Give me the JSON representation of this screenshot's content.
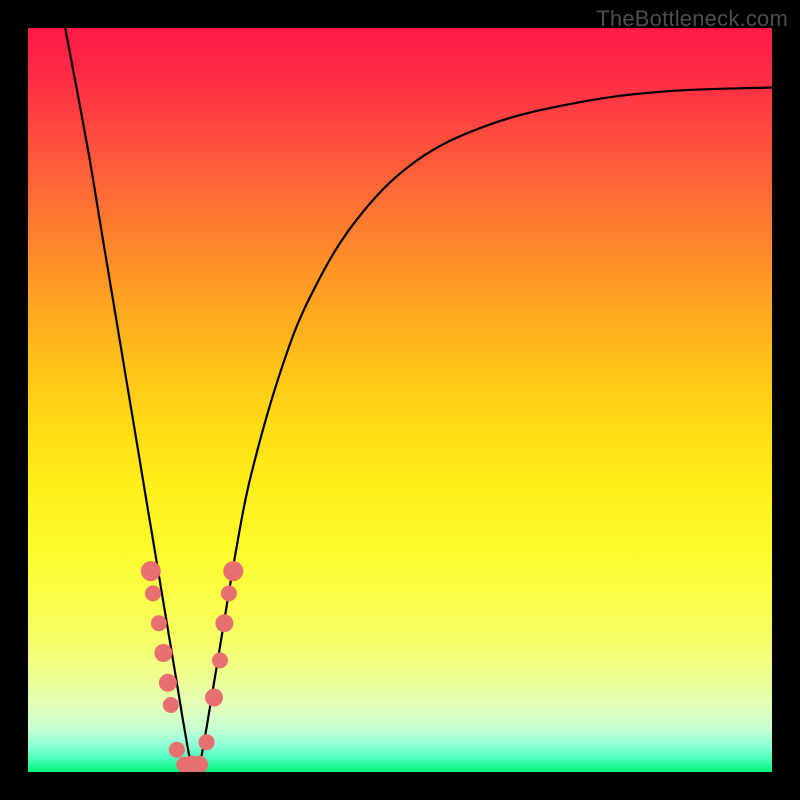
{
  "watermark": "TheBottleneck.com",
  "chart_data": {
    "type": "line",
    "title": "",
    "xlabel": "",
    "ylabel": "",
    "xlim": [
      0,
      100
    ],
    "ylim": [
      0,
      100
    ],
    "series": [
      {
        "name": "bottleneck-curve",
        "x": [
          5,
          8,
          10,
          12,
          14,
          16,
          18,
          20,
          21,
          22,
          23,
          24,
          26,
          28,
          30,
          34,
          38,
          44,
          52,
          62,
          74,
          86,
          100
        ],
        "y": [
          100,
          84,
          72,
          60,
          48,
          36,
          24,
          12,
          6,
          1,
          1,
          6,
          18,
          30,
          40,
          54,
          64,
          74,
          82,
          87,
          90,
          91.5,
          92
        ]
      }
    ],
    "markers": {
      "name": "highlight-dots",
      "points": [
        {
          "x": 16.5,
          "y": 27,
          "r": 2.0
        },
        {
          "x": 16.8,
          "y": 24,
          "r": 1.6
        },
        {
          "x": 17.6,
          "y": 20,
          "r": 1.6
        },
        {
          "x": 18.2,
          "y": 16,
          "r": 1.8
        },
        {
          "x": 18.8,
          "y": 12,
          "r": 1.8
        },
        {
          "x": 19.2,
          "y": 9,
          "r": 1.6
        },
        {
          "x": 20.0,
          "y": 3,
          "r": 1.6
        },
        {
          "x": 21.0,
          "y": 1,
          "r": 1.6
        },
        {
          "x": 22.0,
          "y": 1,
          "r": 1.8
        },
        {
          "x": 23.0,
          "y": 1,
          "r": 1.8
        },
        {
          "x": 24.0,
          "y": 4,
          "r": 1.6
        },
        {
          "x": 25.0,
          "y": 10,
          "r": 1.8
        },
        {
          "x": 25.8,
          "y": 15,
          "r": 1.6
        },
        {
          "x": 26.4,
          "y": 20,
          "r": 1.8
        },
        {
          "x": 27.0,
          "y": 24,
          "r": 1.6
        },
        {
          "x": 27.6,
          "y": 27,
          "r": 2.0
        }
      ]
    },
    "gradient_stops": [
      {
        "pos": 0,
        "color": "#ff1a48"
      },
      {
        "pos": 50,
        "color": "#ffd018"
      },
      {
        "pos": 80,
        "color": "#fbff40"
      },
      {
        "pos": 100,
        "color": "#00f57a"
      }
    ]
  }
}
